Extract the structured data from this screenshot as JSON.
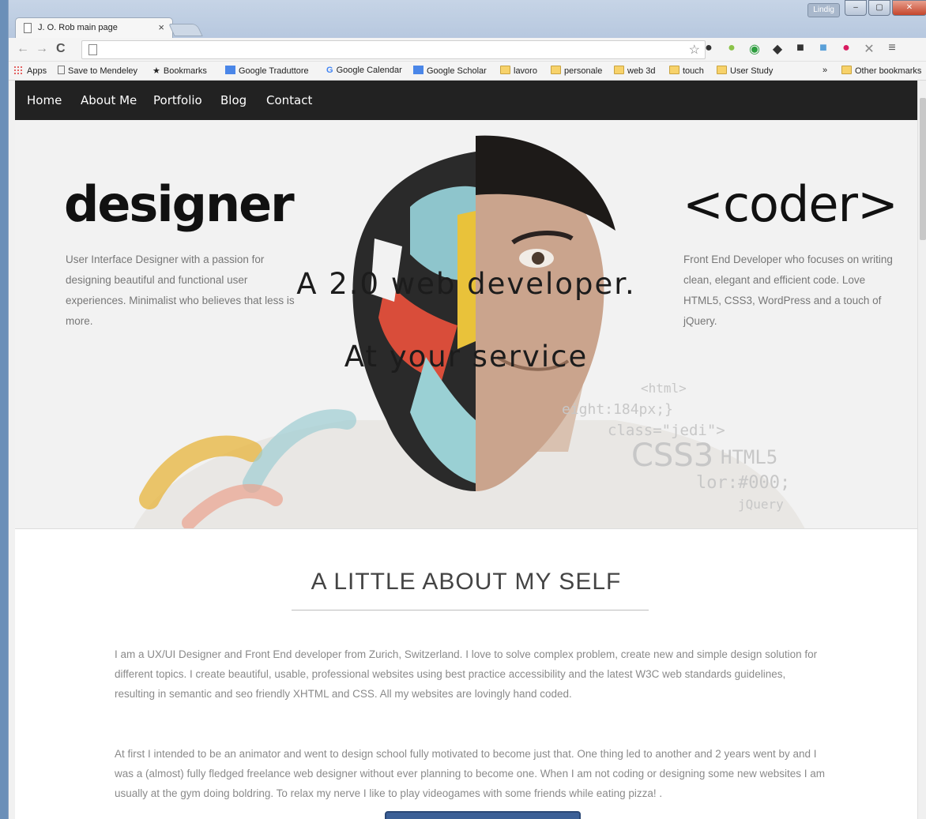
{
  "browser": {
    "tab_title": "J. O. Rob main page",
    "tab_close": "×",
    "user_badge": "Lindig",
    "controls": {
      "minimize": "–",
      "maximize": "▢",
      "close": "✕"
    },
    "back": "←",
    "forward": "→",
    "reload": "C",
    "star": "☆",
    "menu": "≡",
    "extensions": [
      "opera-icon",
      "android-icon",
      "green-d-icon",
      "plug-icon",
      "film-icon",
      "camera-icon",
      "donut-icon",
      "x-icon"
    ]
  },
  "bookmarks": {
    "items": [
      {
        "label": "Apps",
        "icon": "apps-icon"
      },
      {
        "label": "Save to Mendeley",
        "icon": "page-icon"
      },
      {
        "label": "Bookmarks",
        "icon": "star-icon"
      },
      {
        "label": "Google Traduttore",
        "icon": "translate-icon"
      },
      {
        "label": "Google Calendar",
        "icon": "google-icon"
      },
      {
        "label": "Google Scholar",
        "icon": "scholar-icon"
      },
      {
        "label": "lavoro",
        "icon": "folder-icon"
      },
      {
        "label": "personale",
        "icon": "folder-icon"
      },
      {
        "label": "web 3d",
        "icon": "folder-icon"
      },
      {
        "label": "touch",
        "icon": "folder-icon"
      },
      {
        "label": "User Study",
        "icon": "folder-icon"
      }
    ],
    "overflow": "»",
    "other": "Other bookmarks"
  },
  "site": {
    "nav": [
      "Home",
      "About Me",
      "Portfolio",
      "Blog",
      "Contact"
    ],
    "hero": {
      "left_word": "designer",
      "left_desc": "User Interface Designer with a passion for designing beautiful and functional user experiences. Minimalist who believes that less is more.",
      "right_word": "<coder>",
      "right_desc": "Front End Developer who focuses on writing clean, elegant and efficient code. Love HTML5, CSS3, WordPress and a touch of jQuery.",
      "title1": "A 2.0 web developer.",
      "title2": "At your service",
      "code": [
        "<html>",
        "eight:184px;}",
        "class=\"jedi\">",
        "CSS3",
        "HTML5",
        "lor:#000;",
        "jQuery"
      ]
    },
    "about": {
      "title": "A LITTLE ABOUT MY SELF",
      "p1": "I am a UX/UI Designer and Front End developer from Zurich, Switzerland. I love to solve complex problem, create new and simple design solution for different topics. I create beautiful, usable, professional websites using best practice accessibility and the latest W3C web standards guidelines, resulting in semantic and seo friendly XHTML and CSS. All my websites are lovingly hand coded.",
      "p2": "At first I intended to be an animator and went to design school fully motivated to become just that. One thing led to another and 2 years went by and I was a (almost) fully fledged freelance web designer without ever planning to become one. When I am not coding or designing some new websites I am usually at the gym doing boldring. To relax my nerve I like to play videogames with some friends while eating pizza! ."
    }
  }
}
